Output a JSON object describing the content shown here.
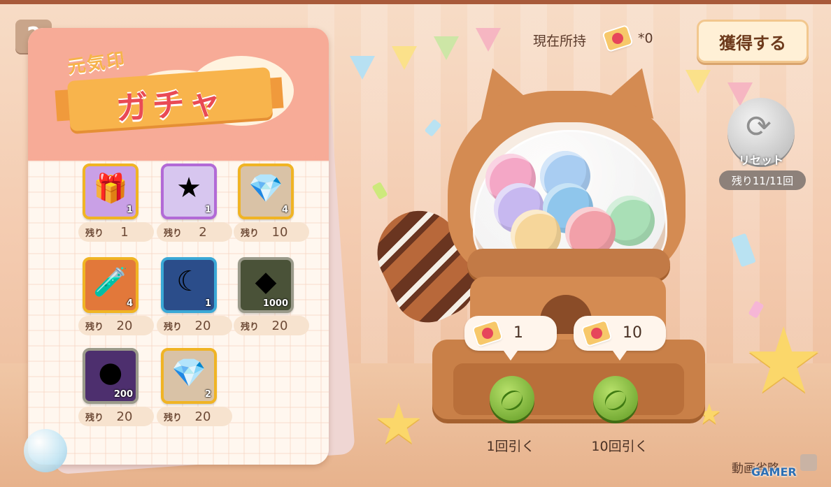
{
  "help": {
    "label": "?"
  },
  "card": {
    "subtitle": "元気印",
    "title": "ガチャ",
    "remain_label": "残り",
    "items": [
      {
        "name": "gift-box",
        "icon": "🎁",
        "qty": "1",
        "remain": "1",
        "frame_color": "#f0b424",
        "bg": "#c9a0e6"
      },
      {
        "name": "star-stone",
        "icon": "★",
        "qty": "1",
        "remain": "2",
        "frame_color": "#b26ad6",
        "bg": "#d7c6ef"
      },
      {
        "name": "rainbow-crystal",
        "icon": "💎",
        "qty": "4",
        "remain": "10",
        "frame_color": "#f0b424",
        "bg": "#d9c2a6"
      },
      {
        "name": "red-potion",
        "icon": "🧪",
        "qty": "4",
        "remain": "20",
        "frame_color": "#f0b424",
        "bg": "#e2783a"
      },
      {
        "name": "crescent-moon",
        "icon": "☾",
        "qty": "1",
        "remain": "20",
        "frame_color": "#3aa8d6",
        "bg": "#2b4d8a"
      },
      {
        "name": "green-gem",
        "icon": "◆",
        "qty": "1000",
        "remain": "20",
        "frame_color": "#9a9a8a",
        "bg": "#4a5238"
      },
      {
        "name": "purple-orb",
        "icon": "●",
        "qty": "200",
        "remain": "20",
        "frame_color": "#9a9a8a",
        "bg": "#4d2f6e"
      },
      {
        "name": "prism-crystal",
        "icon": "💎",
        "qty": "2",
        "remain": "20",
        "frame_color": "#f0b424",
        "bg": "#d9c2a6"
      }
    ]
  },
  "owned": {
    "label": "現在所持",
    "count": "*0"
  },
  "get_button": {
    "label": "獲得する"
  },
  "reset": {
    "label": "リセット",
    "remaining": "残り11/11回"
  },
  "pulls": {
    "single": {
      "cost": "1",
      "label": "1回引く"
    },
    "ten": {
      "cost": "10",
      "label": "10回引く"
    }
  },
  "skip": {
    "label": "動画省略"
  },
  "watermark": "GAMER",
  "colors": {
    "accent": "#e94a55",
    "ribbon": "#f8b44c",
    "button_green": "#7cb83a"
  }
}
